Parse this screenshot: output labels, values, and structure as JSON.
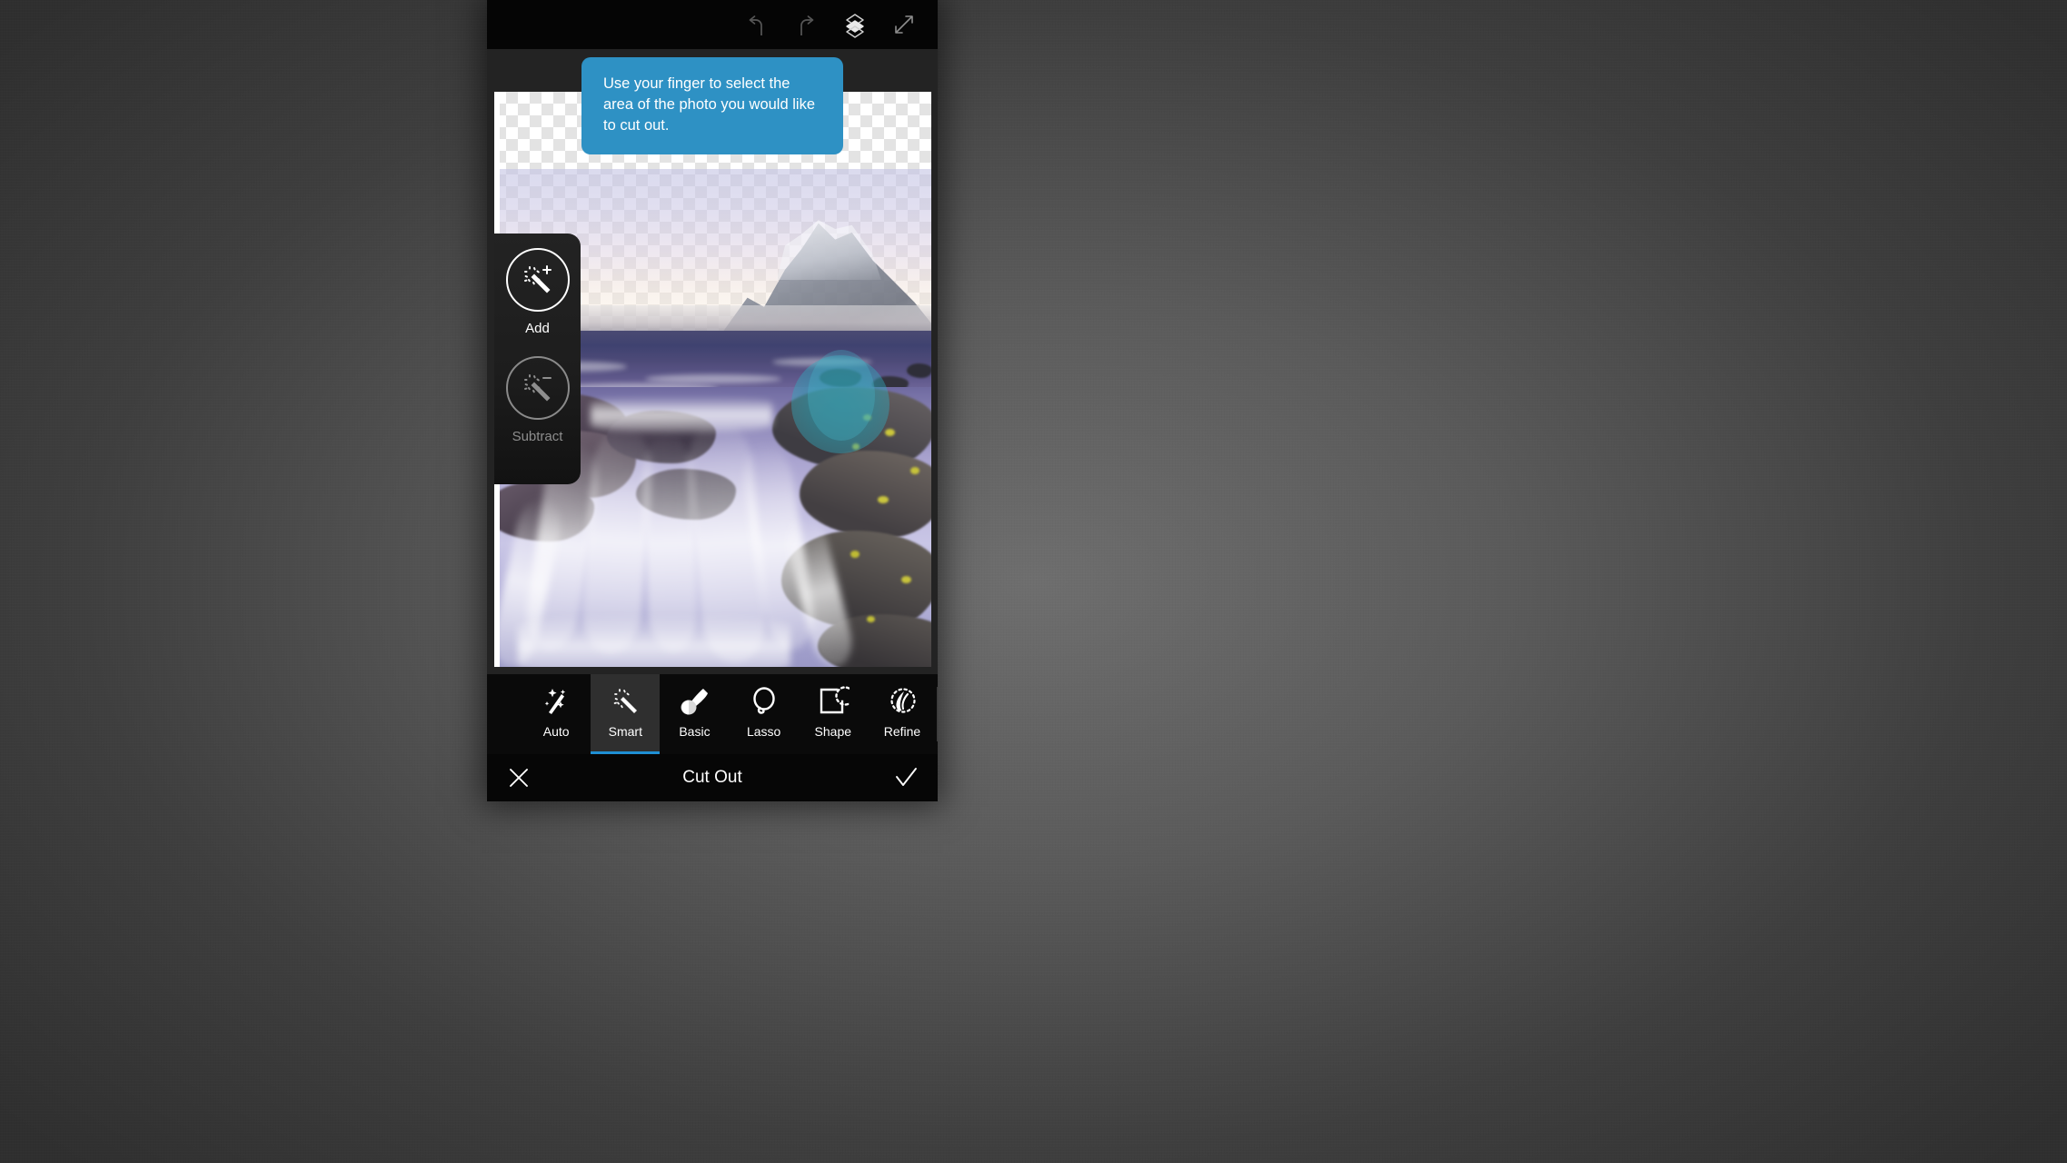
{
  "app": {
    "screen_title": "Cut Out"
  },
  "topbar": {
    "icons": [
      {
        "name": "undo-icon",
        "label": "Undo"
      },
      {
        "name": "redo-icon",
        "label": "Redo"
      },
      {
        "name": "layers-icon",
        "label": "Layers"
      },
      {
        "name": "expand-icon",
        "label": "Expand"
      }
    ]
  },
  "tooltip": {
    "text": "Use your finger to select the area of the photo you would like to cut out.",
    "color": "#2e91c4"
  },
  "flyout": {
    "add": {
      "label": "Add",
      "icon": "magic-wand-plus-icon",
      "selected": true
    },
    "subtract": {
      "label": "Subtract",
      "icon": "magic-wand-minus-icon",
      "selected": false
    }
  },
  "canvas": {
    "touch_indicator": {
      "name": "touch-point-indicator",
      "color": "#2496aa"
    }
  },
  "tools": [
    {
      "label": "Auto",
      "icon": "auto-wand-icon",
      "active": false
    },
    {
      "label": "Smart",
      "icon": "smart-wand-icon",
      "active": true
    },
    {
      "label": "Basic",
      "icon": "brush-icon",
      "active": false
    },
    {
      "label": "Lasso",
      "icon": "lasso-icon",
      "active": false
    },
    {
      "label": "Shape",
      "icon": "shape-select-icon",
      "active": false
    },
    {
      "label": "Refine",
      "icon": "refine-icon",
      "active": false
    }
  ],
  "actionbar": {
    "cancel": {
      "label": "Cancel",
      "icon": "close-x-icon"
    },
    "title": "Cut Out",
    "confirm": {
      "label": "Apply",
      "icon": "checkmark-icon"
    }
  },
  "theme": {
    "accent": "#1f8fd4",
    "tooltip_bg": "#2e91c4",
    "panel_bg": "#0a0a0a",
    "active_tab_bg": "#2f2f2f"
  }
}
